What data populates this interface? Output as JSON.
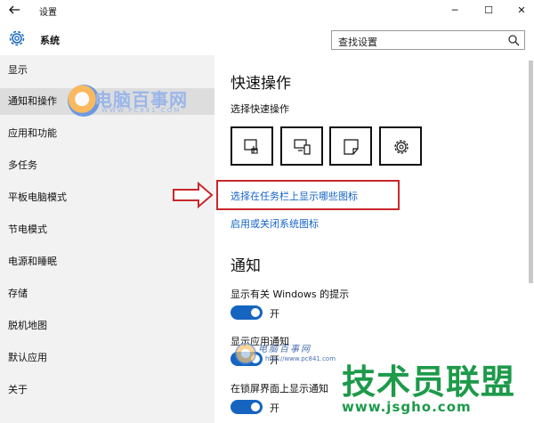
{
  "window": {
    "title": "设置",
    "back_icon": "back-arrow-icon",
    "controls": {
      "minimize": "─",
      "maximize": "☐",
      "close": "✕"
    }
  },
  "header": {
    "section": "系统",
    "icon": "gear-icon",
    "search_placeholder": "查找设置"
  },
  "sidebar": {
    "items": [
      {
        "label": "显示"
      },
      {
        "label": "通知和操作",
        "active": true
      },
      {
        "label": "应用和功能"
      },
      {
        "label": "多任务"
      },
      {
        "label": "平板电脑模式"
      },
      {
        "label": "节电模式"
      },
      {
        "label": "电源和睡眠"
      },
      {
        "label": "存储"
      },
      {
        "label": "脱机地图"
      },
      {
        "label": "默认应用"
      },
      {
        "label": "关于"
      }
    ]
  },
  "main": {
    "quick_actions": {
      "heading": "快速操作",
      "subheading": "选择快速操作",
      "tiles": [
        "tablet-mode-icon",
        "connect-icon",
        "note-icon",
        "settings-icon"
      ],
      "link_taskbar_icons": "选择在任务栏上显示哪些图标",
      "link_system_icons": "启用或关闭系统图标"
    },
    "notifications": {
      "heading": "通知",
      "settings": [
        {
          "label": "显示有关 Windows 的提示",
          "state": "开",
          "on": true
        },
        {
          "label": "显示应用通知",
          "state": "开",
          "on": true
        },
        {
          "label": "在锁屏界面上显示通知",
          "state": "开",
          "on": true
        }
      ]
    }
  },
  "watermarks": {
    "top": {
      "name": "电脑百事网",
      "url": "WWW.PC841.COM"
    },
    "bottom_small": {
      "name": "电脑百事网",
      "url": "http://www.pc841.com"
    },
    "bottom_large": {
      "name": "技术员联盟",
      "url": "www.jsgho.com"
    }
  },
  "colors": {
    "accent": "#1565c0",
    "link": "#1464c8",
    "highlight": "#c8282d",
    "sidebar_bg": "#f2f2f2"
  }
}
